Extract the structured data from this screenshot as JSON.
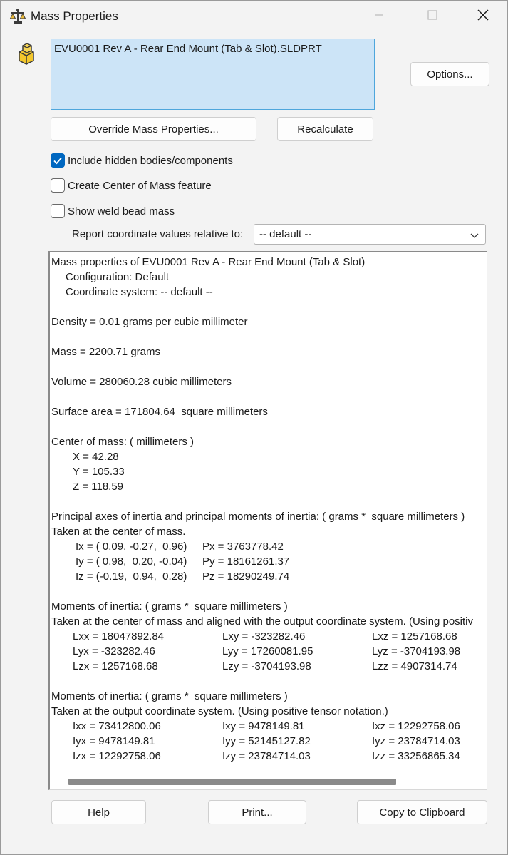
{
  "window": {
    "title": "Mass Properties",
    "icon": "balance-scale-icon",
    "controls": [
      "minimize-icon",
      "maximize-icon",
      "close-icon"
    ]
  },
  "selection": {
    "icon": "part-icon",
    "items": [
      "EVU0001 Rev A - Rear End Mount (Tab & Slot).SLDPRT"
    ]
  },
  "buttons": {
    "options": "Options...",
    "override": "Override Mass Properties...",
    "recalculate": "Recalculate",
    "help": "Help",
    "print": "Print...",
    "copy": "Copy to Clipboard"
  },
  "checkboxes": [
    {
      "label": "Include hidden bodies/components",
      "checked": true
    },
    {
      "label": "Create Center of Mass feature",
      "checked": false
    },
    {
      "label": "Show weld bead mass",
      "checked": false
    }
  ],
  "report": {
    "label": "Report coordinate values relative to:",
    "selected": "-- default --"
  },
  "results": {
    "header": "Mass properties of EVU0001 Rev A - Rear End Mount (Tab & Slot)",
    "configuration": "Configuration: Default",
    "coord_system": "Coordinate system: -- default --",
    "density": "Density = 0.01 grams per cubic millimeter",
    "mass": "Mass = 2200.71 grams",
    "volume": "Volume = 280060.28 cubic millimeters",
    "surface_area": "Surface area = 171804.64  square millimeters",
    "com_title": "Center of mass: ( millimeters )",
    "com_x": "X = 42.28",
    "com_y": "Y = 105.33",
    "com_z": "Z = 118.59",
    "principal_title": "Principal axes of inertia and principal moments of inertia: ( grams *  square millimeters )",
    "principal_sub": "Taken at the center of mass.",
    "ix": "Ix = ( 0.09, -0.27,  0.96)",
    "iy": "Iy = ( 0.98,  0.20, -0.04)",
    "iz": "Iz = (-0.19,  0.94,  0.28)",
    "px": "Px = 3763778.42",
    "py": "Py = 18161261.37",
    "pz": "Pz = 18290249.74",
    "moi_title_1": "Moments of inertia: ( grams *  square millimeters )",
    "moi_sub_1": "Taken at the center of mass and aligned with the output coordinate system. (Using positiv",
    "lxx": "Lxx = 18047892.84",
    "lxy": "Lxy = -323282.46",
    "lxz": "Lxz = 1257168.68",
    "lyx": "Lyx = -323282.46",
    "lyy": "Lyy = 17260081.95",
    "lyz": "Lyz = -3704193.98",
    "lzx": "Lzx = 1257168.68",
    "lzy": "Lzy = -3704193.98",
    "lzz": "Lzz = 4907314.74",
    "moi_title_2": "Moments of inertia: ( grams *  square millimeters )",
    "moi_sub_2": "Taken at the output coordinate system. (Using positive tensor notation.)",
    "ixx": "Ixx = 73412800.06",
    "ixy": "Ixy = 9478149.81",
    "ixz": "Ixz = 12292758.06",
    "iyx": "Iyx = 9478149.81",
    "iyy": "Iyy = 52145127.82",
    "iyz": "Iyz = 23784714.03",
    "izx": "Izx = 12292758.06",
    "izy": "Izy = 23784714.03",
    "izz": "Izz = 33256865.34"
  },
  "colors": {
    "selection_bg": "#cce4f7",
    "selection_border": "#4ea6dc",
    "checkbox_accent": "#0067c0"
  }
}
